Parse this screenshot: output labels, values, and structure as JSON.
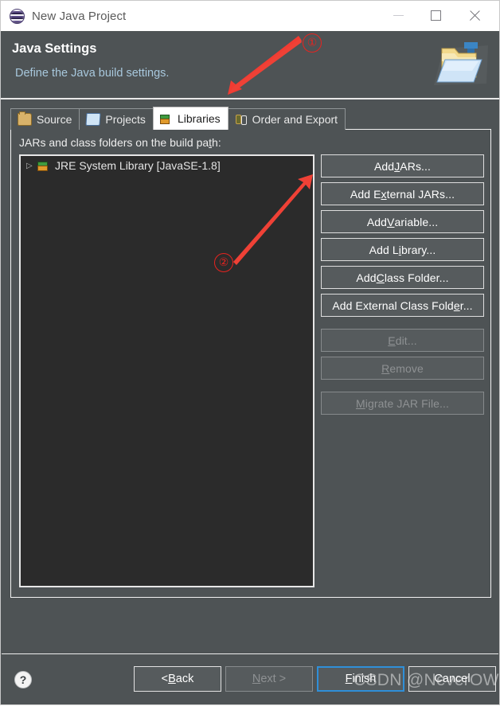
{
  "window": {
    "title": "New Java Project",
    "icon": "eclipse-sphere-icon",
    "controls": {
      "minimize": "minimize-icon",
      "maximize": "maximize-icon",
      "close": "close-icon"
    }
  },
  "header": {
    "title": "Java Settings",
    "description": "Define the Java build settings.",
    "image": "java-project-folder-icon"
  },
  "tabs": [
    {
      "label": "Source",
      "icon": "package-icon",
      "active": false
    },
    {
      "label": "Projects",
      "icon": "folder-icon",
      "active": false
    },
    {
      "label": "Libraries",
      "icon": "books-icon",
      "active": true
    },
    {
      "label": "Order and Export",
      "icon": "order-export-icon",
      "active": false
    }
  ],
  "main": {
    "panel_label": "JARs and class folders on the build path:",
    "panel_label_mnemonic": "t",
    "tree": {
      "items": [
        {
          "label": "JRE System Library [JavaSE-1.8]",
          "icon": "jre-library-icon",
          "expander": "▷",
          "expanded": false
        }
      ]
    },
    "buttons": [
      {
        "label": "Add JARs...",
        "mnemonic": "J",
        "enabled": true
      },
      {
        "label": "Add External JARs...",
        "mnemonic": "x",
        "enabled": true
      },
      {
        "label": "Add Variable...",
        "mnemonic": "V",
        "enabled": true
      },
      {
        "label": "Add Library...",
        "mnemonic": "i",
        "enabled": true
      },
      {
        "label": "Add Class Folder...",
        "mnemonic": "C",
        "enabled": true
      },
      {
        "label": "Add External Class Folder...",
        "mnemonic": "e",
        "enabled": true
      },
      {
        "label": "Edit...",
        "mnemonic": "E",
        "enabled": false
      },
      {
        "label": "Remove",
        "mnemonic": "R",
        "enabled": false
      },
      {
        "label": "Migrate JAR File...",
        "mnemonic": "M",
        "enabled": false
      }
    ]
  },
  "footer": {
    "help": "?",
    "buttons": [
      {
        "label": "< Back",
        "mnemonic": "B",
        "enabled": true,
        "focused": false
      },
      {
        "label": "Next >",
        "mnemonic": "N",
        "enabled": false,
        "focused": false
      },
      {
        "label": "Finish",
        "mnemonic": "F",
        "enabled": true,
        "focused": true
      },
      {
        "label": "Cancel",
        "mnemonic": "",
        "enabled": true,
        "focused": false
      }
    ]
  },
  "watermark": "CSDN @NeverOW",
  "annotations": {
    "accent_color": "#e8231f",
    "markers": [
      {
        "id": "1",
        "label": "①",
        "target": "libraries-tab"
      },
      {
        "id": "2",
        "label": "②",
        "target": "add-external-jars-button"
      }
    ]
  },
  "colors": {
    "dialog_bg": "#4e5355",
    "titlebar_bg": "#ffffff",
    "tree_bg": "#2b2b2b",
    "button_bg": "#565b5d",
    "border": "#e2e2e2",
    "link_text": "#a8c8dd",
    "focus_blue": "#2f8fd8",
    "disabled_text": "#8e9193"
  }
}
